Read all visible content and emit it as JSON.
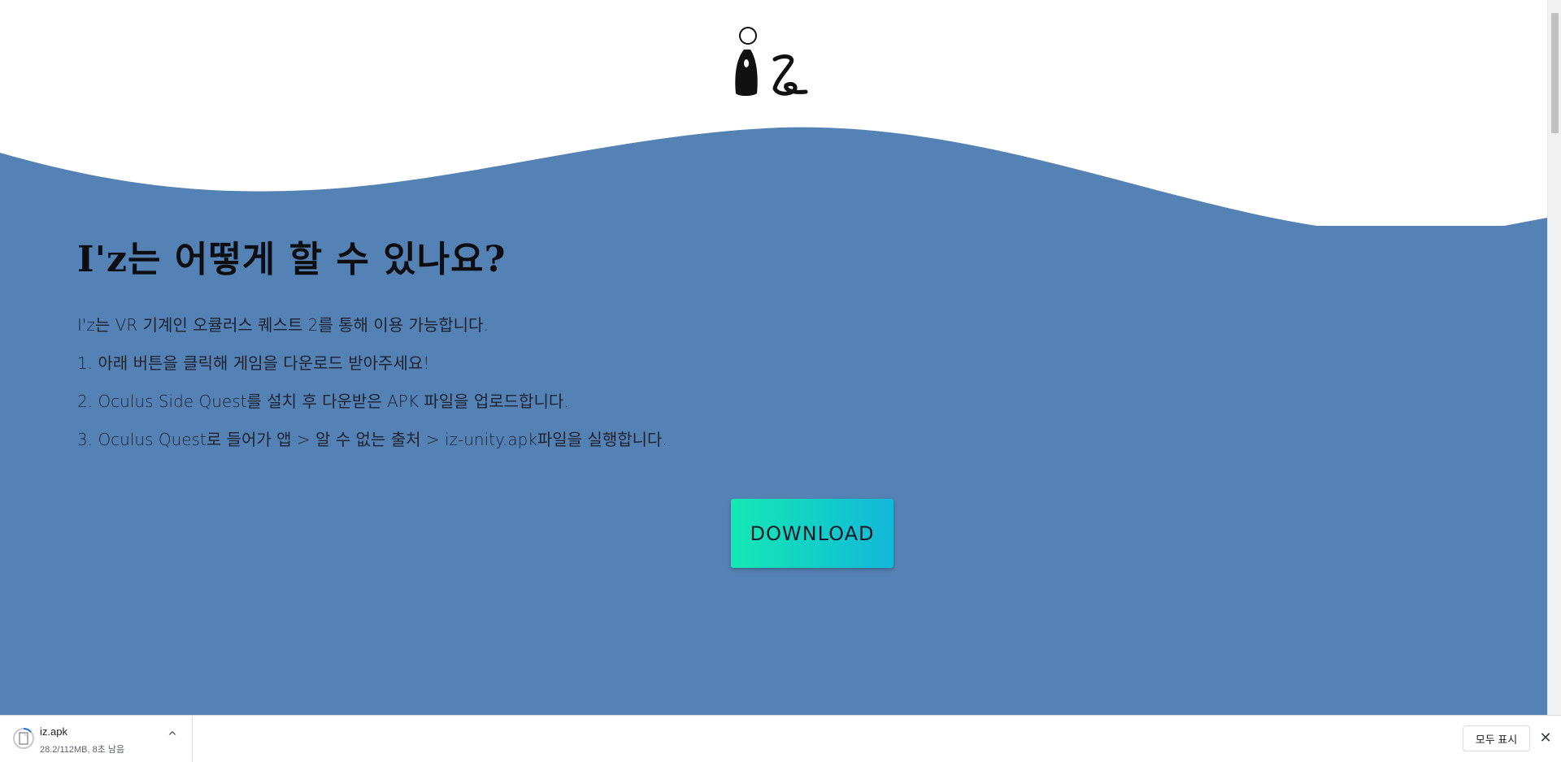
{
  "page": {
    "heading": "I'z는 어떻게 할 수 있나요?",
    "paragraphs": [
      "I'z는 VR 기계인 오큘러스 퀘스트 2를 통해 이용 가능합니다.",
      "1. 아래 버튼을 클릭해 게임을 다운로드 받아주세요!",
      "2. Oculus Side Quest를 설치 후 다운받은 APK 파일을 업로드합니다.",
      "3. Oculus Quest로 들어가 앱 > 알 수 없는 출처 > iz-unity.apk파일을 실행합니다."
    ],
    "download_label": "DOWNLOAD",
    "logo_icon": "iz-logo-icon"
  },
  "colors": {
    "wave_background": "#5582b4",
    "button_gradient_start": "#14e8b3",
    "button_gradient_end": "#12b8d9"
  },
  "download_shelf": {
    "file_name": "iz.apk",
    "status": "28.2/112MB, 8초 남음",
    "chevron": "^",
    "show_all_label": "모두 표시",
    "close_label": "✕"
  }
}
